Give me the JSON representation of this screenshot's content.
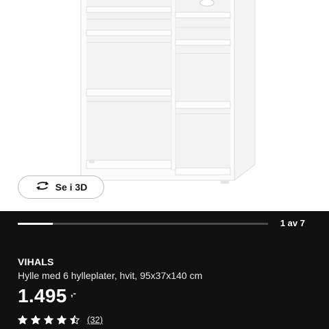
{
  "gallery": {
    "view_3d_label": "Se i 3D",
    "counter": "1 av 7",
    "progress": 0.14
  },
  "product": {
    "name": "VIHALS",
    "description": "Hylle med 6 hylleplater, hvit, 95x37x140 cm",
    "price": "1.495",
    "price_suffix": ",-",
    "rating": 4.5,
    "rating_max": 5,
    "review_count": "(32)"
  },
  "colors": {
    "panel": "#111111",
    "text": "#ffffff"
  },
  "icons": {
    "view_3d": "rotate-3d-icon",
    "star": "star-icon"
  }
}
